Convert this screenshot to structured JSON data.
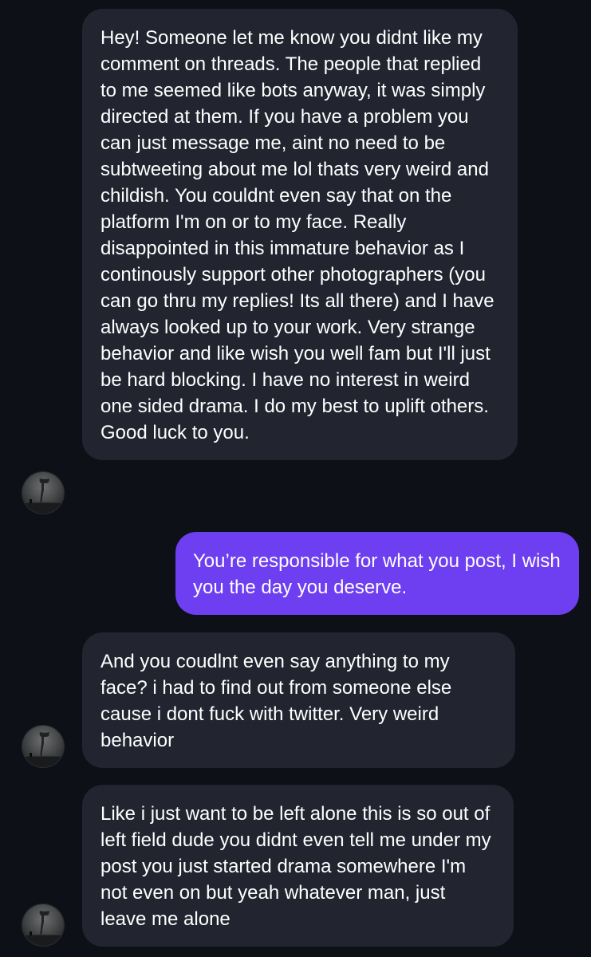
{
  "messages": [
    {
      "sender": "other",
      "text": "Hey! Someone let me know you didnt like my comment on threads. The people that replied to me seemed like bots anyway, it was simply directed at them. If you have a problem you can just message me, aint no need to be subtweeting about me lol thats very weird and childish. You couldnt even say that on the platform I'm on or to my face. Really disappointed in this immature behavior as I continously support other photographers (you can go thru my replies! Its all there) and I have always looked up to your work. Very strange behavior and like wish you well fam but I'll just be hard blocking. I have no interest in weird one sided drama. I do my best to uplift others. Good luck to you."
    },
    {
      "sender": "me",
      "text": "You’re responsible for what you post, I wish you the day you deserve."
    },
    {
      "sender": "other",
      "text": "And you coudlnt even say anything to my face? i had to find out from someone else cause i dont fuck with twitter. Very weird behavior"
    },
    {
      "sender": "other",
      "text": "Like i just want to be left alone this is so out of left field dude you didnt even tell me under my post you just started drama somewhere I'm not even on but yeah whatever man, just leave me alone"
    }
  ],
  "colors": {
    "background": "#0d1017",
    "incoming_bubble": "#222530",
    "outgoing_bubble": "#6d3ff0",
    "text": "#ffffff"
  }
}
